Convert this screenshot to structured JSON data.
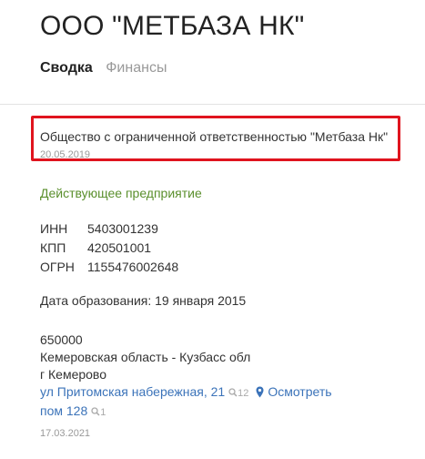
{
  "company": {
    "title": "ООО \"МЕТБАЗА НК\"",
    "full_name": "Общество с ограниченной ответственностью \"Метбаза Нк\"",
    "name_date": "20.05.2019",
    "status": "Действующее предприятие"
  },
  "tabs": [
    {
      "label": "Сводка",
      "active": true
    },
    {
      "label": "Финансы",
      "active": false
    }
  ],
  "codes": [
    {
      "label": "ИНН",
      "value": "5403001239"
    },
    {
      "label": "КПП",
      "value": "420501001"
    },
    {
      "label": "ОГРН",
      "value": "1155476002648"
    }
  ],
  "founded": "Дата образования: 19 января 2015",
  "address": {
    "zip": "650000",
    "region": "Кемеровская область - Кузбасс обл",
    "city": "г Кемерово",
    "street": "ул Притомская набережная, 21",
    "street_count": "12",
    "view_label": "Осмотреть",
    "room": "пом 128",
    "room_count": "1",
    "date": "17.03.2021"
  },
  "colors": {
    "highlight_border": "#e0141e",
    "status": "#5a8f2c",
    "link": "#3b73b9"
  }
}
